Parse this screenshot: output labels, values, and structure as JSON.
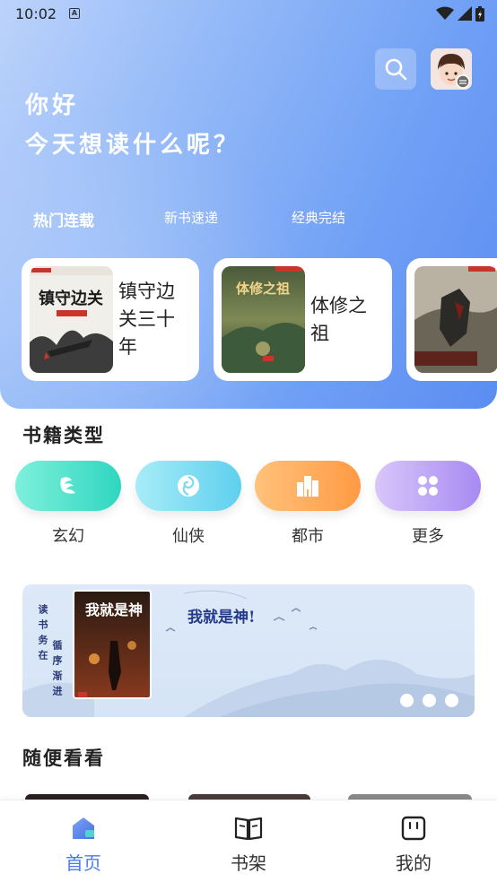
{
  "status_bar": {
    "time": "10:02"
  },
  "header": {
    "greeting_line1": "你好",
    "greeting_line2": "今天想读什么呢？"
  },
  "tabs": [
    {
      "label": "热门连载",
      "active": true
    },
    {
      "label": "新书速递",
      "active": false
    },
    {
      "label": "经典完结",
      "active": false
    }
  ],
  "hot_books": [
    {
      "title": "镇守边关三十年",
      "cover_text": "镇守边关"
    },
    {
      "title": "体修之祖",
      "cover_text": "体修之祖"
    },
    {
      "title": "",
      "cover_text": ""
    }
  ],
  "genres_section": {
    "title": "书籍类型",
    "items": [
      {
        "label": "玄幻",
        "icon": "dragon-icon",
        "color_from": "#7ff0dc",
        "color_to": "#2fd6c0"
      },
      {
        "label": "仙侠",
        "icon": "swirl-icon",
        "color_from": "#a7ecf8",
        "color_to": "#5fd0ee"
      },
      {
        "label": "都市",
        "icon": "building-icon",
        "color_from": "#ffc27a",
        "color_to": "#ff9a45"
      },
      {
        "label": "更多",
        "icon": "grid-icon",
        "color_from": "#d8c6fb",
        "color_to": "#a88af2"
      }
    ]
  },
  "banner": {
    "vertical_text_1": "读书务在",
    "vertical_text_2": "循序渐进",
    "cover_title": "我就是神",
    "title": "我就是神!"
  },
  "random_section": {
    "title": "随便看看"
  },
  "bottom_nav": [
    {
      "label": "首页",
      "icon": "home-icon",
      "active": true
    },
    {
      "label": "书架",
      "icon": "book-open-icon",
      "active": false
    },
    {
      "label": "我的",
      "icon": "profile-icon",
      "active": false
    }
  ],
  "colors": {
    "accent": "#4a7bea",
    "hero_start": "#bcd3fb",
    "hero_end": "#5b8df2"
  }
}
